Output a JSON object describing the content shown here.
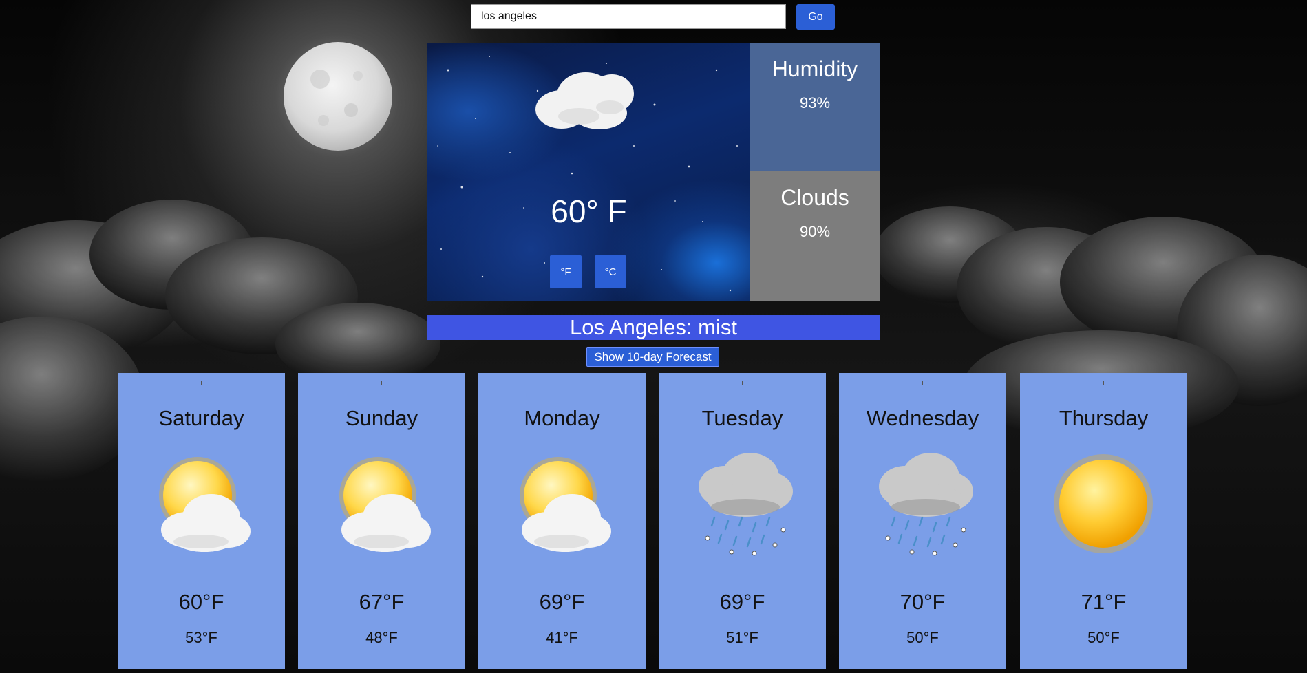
{
  "search": {
    "value": "los angeles",
    "go_label": "Go"
  },
  "current": {
    "temperature": "60° F",
    "unit_f_label": "°F",
    "unit_c_label": "°C",
    "condition_icon": "cloud-icon",
    "humidity_label": "Humidity",
    "humidity_value": "93%",
    "clouds_label": "Clouds",
    "clouds_value": "90%"
  },
  "location": {
    "title": "Los Angeles: mist"
  },
  "forecast_button_label": "Show 10-day Forecast",
  "forecast": [
    {
      "day": "Saturday",
      "high": "60°F",
      "low": "53°F",
      "icon": "partly-cloudy-icon"
    },
    {
      "day": "Sunday",
      "high": "67°F",
      "low": "48°F",
      "icon": "partly-cloudy-icon"
    },
    {
      "day": "Monday",
      "high": "69°F",
      "low": "41°F",
      "icon": "partly-cloudy-icon"
    },
    {
      "day": "Tuesday",
      "high": "69°F",
      "low": "51°F",
      "icon": "rain-icon"
    },
    {
      "day": "Wednesday",
      "high": "70°F",
      "low": "50°F",
      "icon": "rain-icon"
    },
    {
      "day": "Thursday",
      "high": "71°F",
      "low": "50°F",
      "icon": "sun-icon"
    }
  ],
  "colors": {
    "accent": "#2b5fd6",
    "location_bar": "#3f55e3",
    "card": "#7b9ee8",
    "humidity_panel": "#4a6696",
    "clouds_panel": "#7d7d7d"
  }
}
